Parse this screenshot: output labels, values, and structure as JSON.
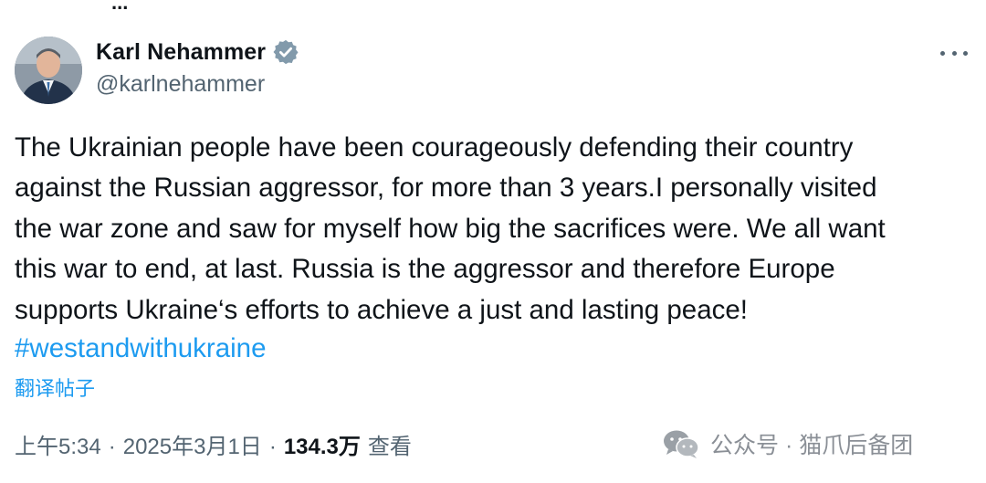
{
  "header_fragment": "...",
  "author": {
    "display_name": "Karl Nehammer",
    "handle": "@karlnehammer",
    "verified": true
  },
  "tweet": {
    "text_lines": [
      "The Ukrainian people have been courageously defending their country",
      "against the Russian aggressor, for more than 3 years.I personally visited",
      "the war zone and saw for myself how big the sacrifices were. We all want",
      "this war to end, at last. Russia is the aggressor and therefore Europe",
      "supports Ukraine‘s efforts to achieve a just and lasting peace!"
    ],
    "hashtag": "#westandwithukraine",
    "translate_label": "翻译帖子"
  },
  "meta": {
    "time": "上午5:34",
    "date": "2025年3月1日",
    "views_count": "134.3万",
    "views_label": "查看",
    "separator": "·"
  },
  "watermark": {
    "text": "公众号 · 猫爪后备团",
    "icon": "wechat-icon"
  },
  "colors": {
    "link": "#1d9bf0",
    "secondary": "#536471",
    "primary_text": "#0f1419",
    "verified_badge": "#829aab"
  }
}
